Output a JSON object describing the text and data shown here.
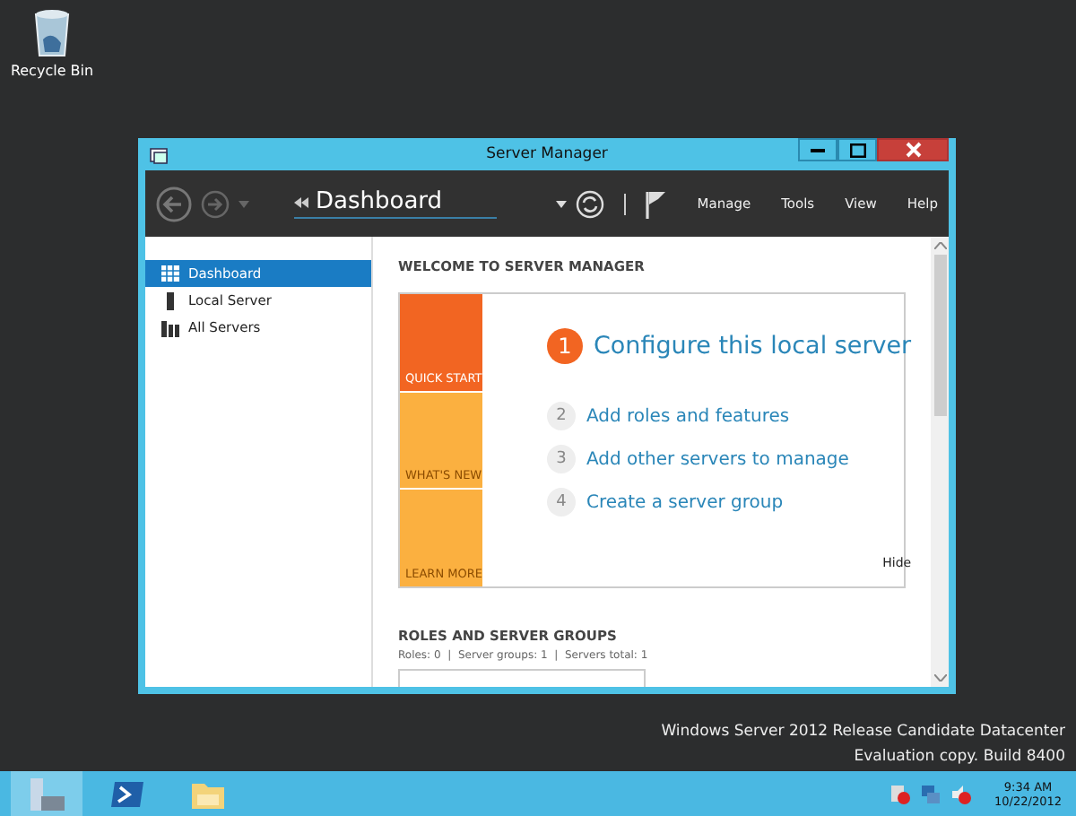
{
  "desktop_icons": [
    {
      "label": "Recycle Bin"
    }
  ],
  "window": {
    "title": "Server Manager"
  },
  "navbar": {
    "title": "Dashboard",
    "menu": [
      "Manage",
      "Tools",
      "View",
      "Help"
    ]
  },
  "sidebar": {
    "items": [
      {
        "label": "Dashboard",
        "kind": "dashboard",
        "selected": true
      },
      {
        "label": "Local Server",
        "kind": "local",
        "selected": false
      },
      {
        "label": "All Servers",
        "kind": "all",
        "selected": false
      }
    ]
  },
  "welcome": {
    "heading": "WELCOME TO SERVER MANAGER",
    "tiles": [
      {
        "label": "QUICK START",
        "selected": true
      },
      {
        "label": "WHAT'S NEW",
        "selected": false
      },
      {
        "label": "LEARN MORE",
        "selected": false
      }
    ],
    "steps": [
      {
        "number": "1",
        "text": "Configure this local server",
        "selected": true
      },
      {
        "number": "2",
        "text": "Add roles and features",
        "selected": false
      },
      {
        "number": "3",
        "text": "Add other servers to manage",
        "selected": false
      },
      {
        "number": "4",
        "text": "Create a server group",
        "selected": false
      }
    ],
    "hide": "Hide"
  },
  "roles": {
    "heading": "ROLES AND SERVER GROUPS",
    "summary": "Roles: 0  |  Server groups: 1  |  Servers total: 1"
  },
  "edition": [
    "Windows Server 2012 Release Candidate Datacenter",
    "Evaluation copy. Build 8400"
  ],
  "taskbar": {
    "time": "9:34 AM",
    "date": "10/22/2012"
  }
}
